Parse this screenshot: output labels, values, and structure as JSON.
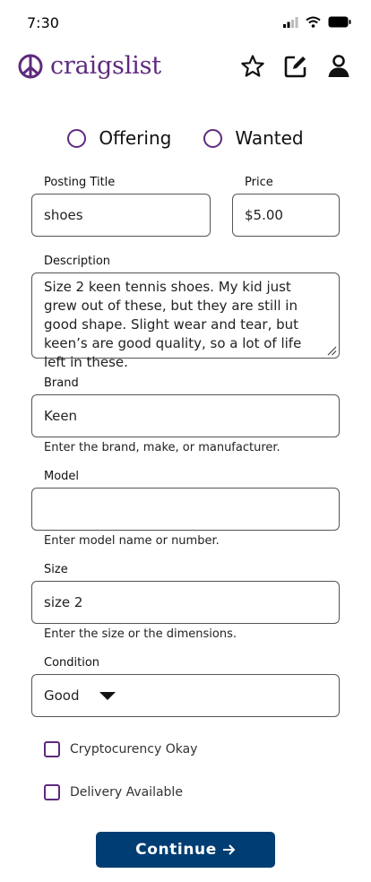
{
  "status_bar": {
    "time": "7:30"
  },
  "header": {
    "logo_text": "craigslist"
  },
  "listing_type": {
    "offering_label": "Offering",
    "wanted_label": "Wanted"
  },
  "form": {
    "title_label": "Posting Title",
    "title_value": "shoes",
    "price_label": "Price",
    "price_value": "$5.00",
    "description_label": "Description",
    "description_value": "Size 2 keen tennis shoes. My kid just grew out of these, but they are still in good shape. Slight wear and tear, but keen’s are good quality, so a lot of life left in these.",
    "brand_label": "Brand",
    "brand_value": "Keen",
    "brand_helper": "Enter the brand, make, or manufacturer.",
    "model_label": "Model",
    "model_value": "",
    "model_helper": "Enter model name or number.",
    "size_label": "Size",
    "size_value": "size 2",
    "size_helper": "Enter the size or the dimensions.",
    "condition_label": "Condition",
    "condition_value": "Good",
    "crypto_label": "Cryptocurency Okay",
    "delivery_label": "Delivery Available"
  },
  "continue_label": "Continue",
  "colors": {
    "brand_purple": "#5e2a7e",
    "button_blue": "#003d73"
  },
  "icons": [
    "peace-icon",
    "star-icon",
    "edit-icon",
    "user-icon",
    "signal-icon",
    "wifi-icon",
    "battery-icon",
    "caret-down-icon",
    "arrow-right-icon"
  ]
}
